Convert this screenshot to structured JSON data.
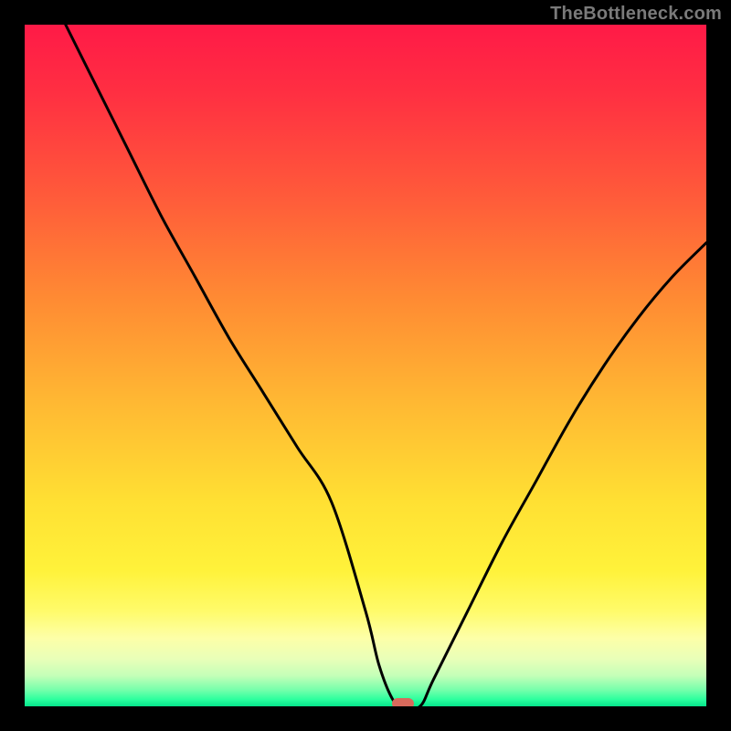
{
  "watermark": "TheBottleneck.com",
  "marker": {
    "color": "#d86a5c",
    "x_pct": 55.5,
    "y_pct": 0
  },
  "gradient_stops": [
    {
      "pct": 0,
      "color": "#ff1a47"
    },
    {
      "pct": 10,
      "color": "#ff2f42"
    },
    {
      "pct": 25,
      "color": "#ff5a3a"
    },
    {
      "pct": 40,
      "color": "#ff8a33"
    },
    {
      "pct": 55,
      "color": "#ffb733"
    },
    {
      "pct": 70,
      "color": "#ffe033"
    },
    {
      "pct": 80,
      "color": "#fff23a"
    },
    {
      "pct": 86,
      "color": "#fffb6a"
    },
    {
      "pct": 90,
      "color": "#fdffa8"
    },
    {
      "pct": 93,
      "color": "#e9ffb8"
    },
    {
      "pct": 95.5,
      "color": "#c4ffb8"
    },
    {
      "pct": 97.5,
      "color": "#7affac"
    },
    {
      "pct": 99,
      "color": "#2bff9e"
    },
    {
      "pct": 100,
      "color": "#06e58b"
    }
  ],
  "chart_data": {
    "type": "line",
    "title": "",
    "xlabel": "",
    "ylabel": "",
    "xlim": [
      0,
      100
    ],
    "ylim": [
      0,
      100
    ],
    "grid": false,
    "legend": false,
    "series": [
      {
        "name": "bottleneck-curve",
        "x": [
          6,
          10,
          15,
          20,
          25,
          30,
          35,
          40,
          45,
          50,
          52,
          54,
          55.5,
          58,
          60,
          65,
          70,
          75,
          80,
          85,
          90,
          95,
          100
        ],
        "y": [
          100,
          92,
          82,
          72,
          63,
          54,
          46,
          38,
          30,
          14,
          6,
          1,
          0,
          0,
          4,
          14,
          24,
          33,
          42,
          50,
          57,
          63,
          68
        ]
      }
    ],
    "marker_point": {
      "x": 55.5,
      "y": 0
    }
  }
}
